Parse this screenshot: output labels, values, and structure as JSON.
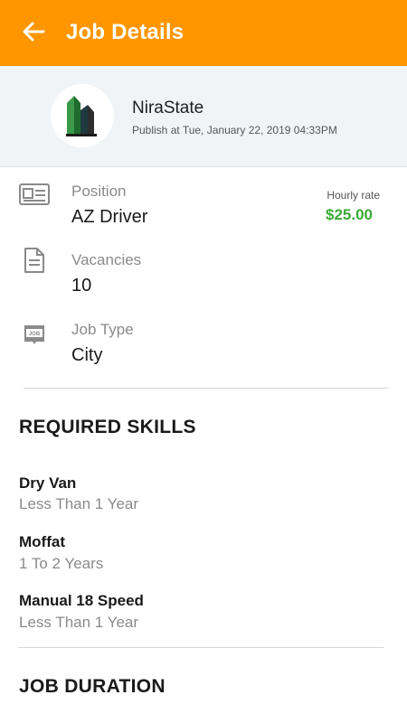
{
  "header": {
    "title": "Job Details",
    "back_icon": "arrow-left-icon",
    "color": "#ff9600"
  },
  "company": {
    "name": "NiraState",
    "published": "Publish at Tue, January 22, 2019 04:33PM"
  },
  "details": {
    "position": {
      "label": "Position",
      "value": "AZ Driver",
      "icon": "id-card-icon"
    },
    "rate": {
      "label": "Hourly rate",
      "value": "$25.00",
      "color": "#3aa935"
    },
    "vacancies": {
      "label": "Vacancies",
      "value": "10",
      "icon": "document-icon"
    },
    "job_type": {
      "label": "Job Type",
      "value": "City",
      "icon": "job-badge-icon",
      "icon_text": "JOB"
    }
  },
  "skills": {
    "title": "REQUIRED SKILLS",
    "items": [
      {
        "name": "Dry Van",
        "experience": "Less Than 1 Year"
      },
      {
        "name": "Moffat",
        "experience": "1 To 2 Years"
      },
      {
        "name": "Manual 18 Speed",
        "experience": "Less Than 1 Year"
      }
    ]
  },
  "duration": {
    "title": "JOB DURATION"
  }
}
